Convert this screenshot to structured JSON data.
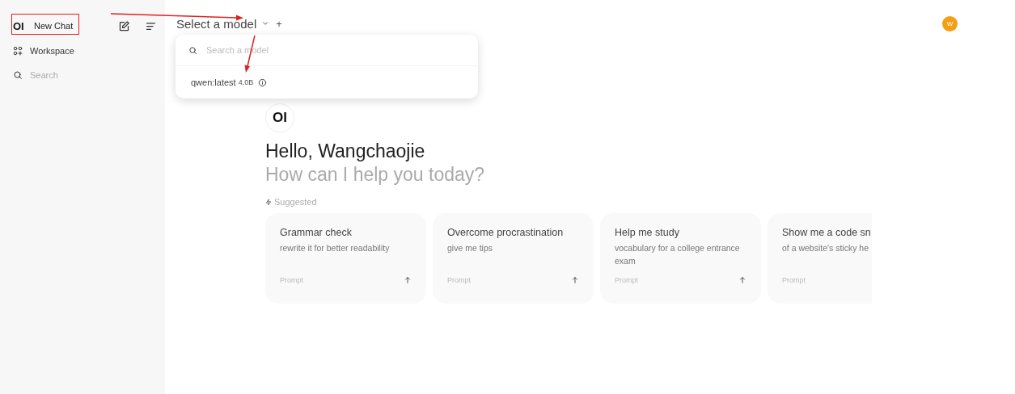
{
  "sidebar": {
    "brand_logo": "OI",
    "new_chat": "New Chat",
    "items": [
      {
        "kind": "link",
        "label": "Workspace"
      },
      {
        "kind": "search",
        "label": "Search"
      }
    ]
  },
  "header": {
    "model_selector": "Select a model",
    "add": "+",
    "avatar": "W"
  },
  "model_menu": {
    "search": {
      "placeholder": "Search a model"
    },
    "models": [
      {
        "name": "qwen:latest",
        "size": "4.0B"
      }
    ]
  },
  "welcome": {
    "logo": "OI",
    "greeting": "Hello, Wangchaojie",
    "subtitle": "How can I help you today?",
    "suggested_label": "Suggested"
  },
  "suggestions": [
    {
      "title": "Grammar check",
      "subtitle": "rewrite it for better readability",
      "footer": "Prompt",
      "show_send": true
    },
    {
      "title": "Overcome procrastination",
      "subtitle": "give me tips",
      "footer": "Prompt",
      "show_send": true
    },
    {
      "title": "Help me study",
      "subtitle": "vocabulary for a college entrance exam",
      "footer": "Prompt",
      "show_send": true
    },
    {
      "title": "Show me a code sn",
      "subtitle": "of a website's sticky he",
      "footer": "Prompt"
    }
  ],
  "annotations": {
    "highlight_box": true,
    "arrows": true
  }
}
